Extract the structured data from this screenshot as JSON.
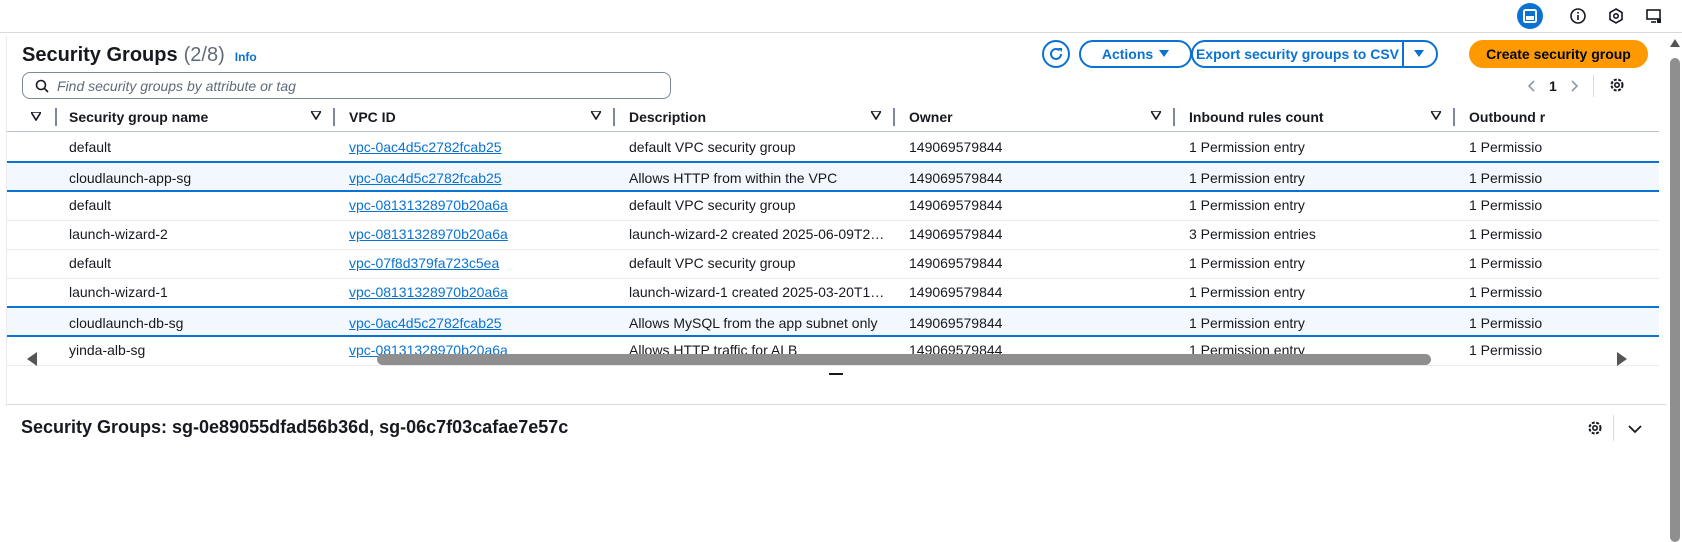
{
  "header": {
    "title": "Security Groups",
    "count": "(2/8)",
    "info_label": "Info"
  },
  "toolbar": {
    "actions_label": "Actions",
    "export_label": "Export security groups to CSV",
    "create_label": "Create security group"
  },
  "search": {
    "placeholder": "Find security groups by attribute or tag",
    "value": ""
  },
  "pagination": {
    "current_page": "1"
  },
  "table": {
    "columns": [
      "Security group name",
      "VPC ID",
      "Description",
      "Owner",
      "Inbound rules count",
      "Outbound r"
    ],
    "rows": [
      {
        "name": "default",
        "vpc": "vpc-0ac4d5c2782fcab25",
        "description": "default VPC security group",
        "owner": "149069579844",
        "inbound": "1 Permission entry",
        "outbound": "1 Permissio",
        "selected": false
      },
      {
        "name": "cloudlaunch-app-sg",
        "vpc": "vpc-0ac4d5c2782fcab25",
        "description": "Allows HTTP from within the VPC",
        "owner": "149069579844",
        "inbound": "1 Permission entry",
        "outbound": "1 Permissio",
        "selected": true
      },
      {
        "name": "default",
        "vpc": "vpc-08131328970b20a6a",
        "description": "default VPC security group",
        "owner": "149069579844",
        "inbound": "1 Permission entry",
        "outbound": "1 Permissio",
        "selected": false
      },
      {
        "name": "launch-wizard-2",
        "vpc": "vpc-08131328970b20a6a",
        "description": "launch-wizard-2 created 2025-06-09T2…",
        "owner": "149069579844",
        "inbound": "3 Permission entries",
        "outbound": "1 Permissio",
        "selected": false
      },
      {
        "name": "default",
        "vpc": "vpc-07f8d379fa723c5ea",
        "description": "default VPC security group",
        "owner": "149069579844",
        "inbound": "1 Permission entry",
        "outbound": "1 Permissio",
        "selected": false
      },
      {
        "name": "launch-wizard-1",
        "vpc": "vpc-08131328970b20a6a",
        "description": "launch-wizard-1 created 2025-03-20T1…",
        "owner": "149069579844",
        "inbound": "1 Permission entry",
        "outbound": "1 Permissio",
        "selected": false
      },
      {
        "name": "cloudlaunch-db-sg",
        "vpc": "vpc-0ac4d5c2782fcab25",
        "description": "Allows MySQL from the app subnet only",
        "owner": "149069579844",
        "inbound": "1 Permission entry",
        "outbound": "1 Permissio",
        "selected": true
      },
      {
        "name": "yinda-alb-sg",
        "vpc": "vpc-08131328970b20a6a",
        "description": "Allows HTTP traffic for ALB",
        "owner": "149069579844",
        "inbound": "1 Permission entry",
        "outbound": "1 Permissio",
        "selected": false
      }
    ]
  },
  "split_panel": {
    "title": "Security Groups: sg-0e89055dfad56b36d, sg-06c7f03cafae7e57c"
  },
  "icons": {
    "topbar": [
      "split-panel-icon",
      "info-icon",
      "hexagon-icon",
      "monitor-icon"
    ],
    "toolbar": [
      "refresh-icon",
      "caret-down-icon",
      "search-icon",
      "chevron-left-icon",
      "chevron-right-icon",
      "gear-icon"
    ]
  },
  "colors": {
    "primary": "#0972d3",
    "create_button": "#ff9900",
    "selected_row_bg": "#f2f8fd",
    "text": "#16191f",
    "muted": "#5f6b7a"
  }
}
